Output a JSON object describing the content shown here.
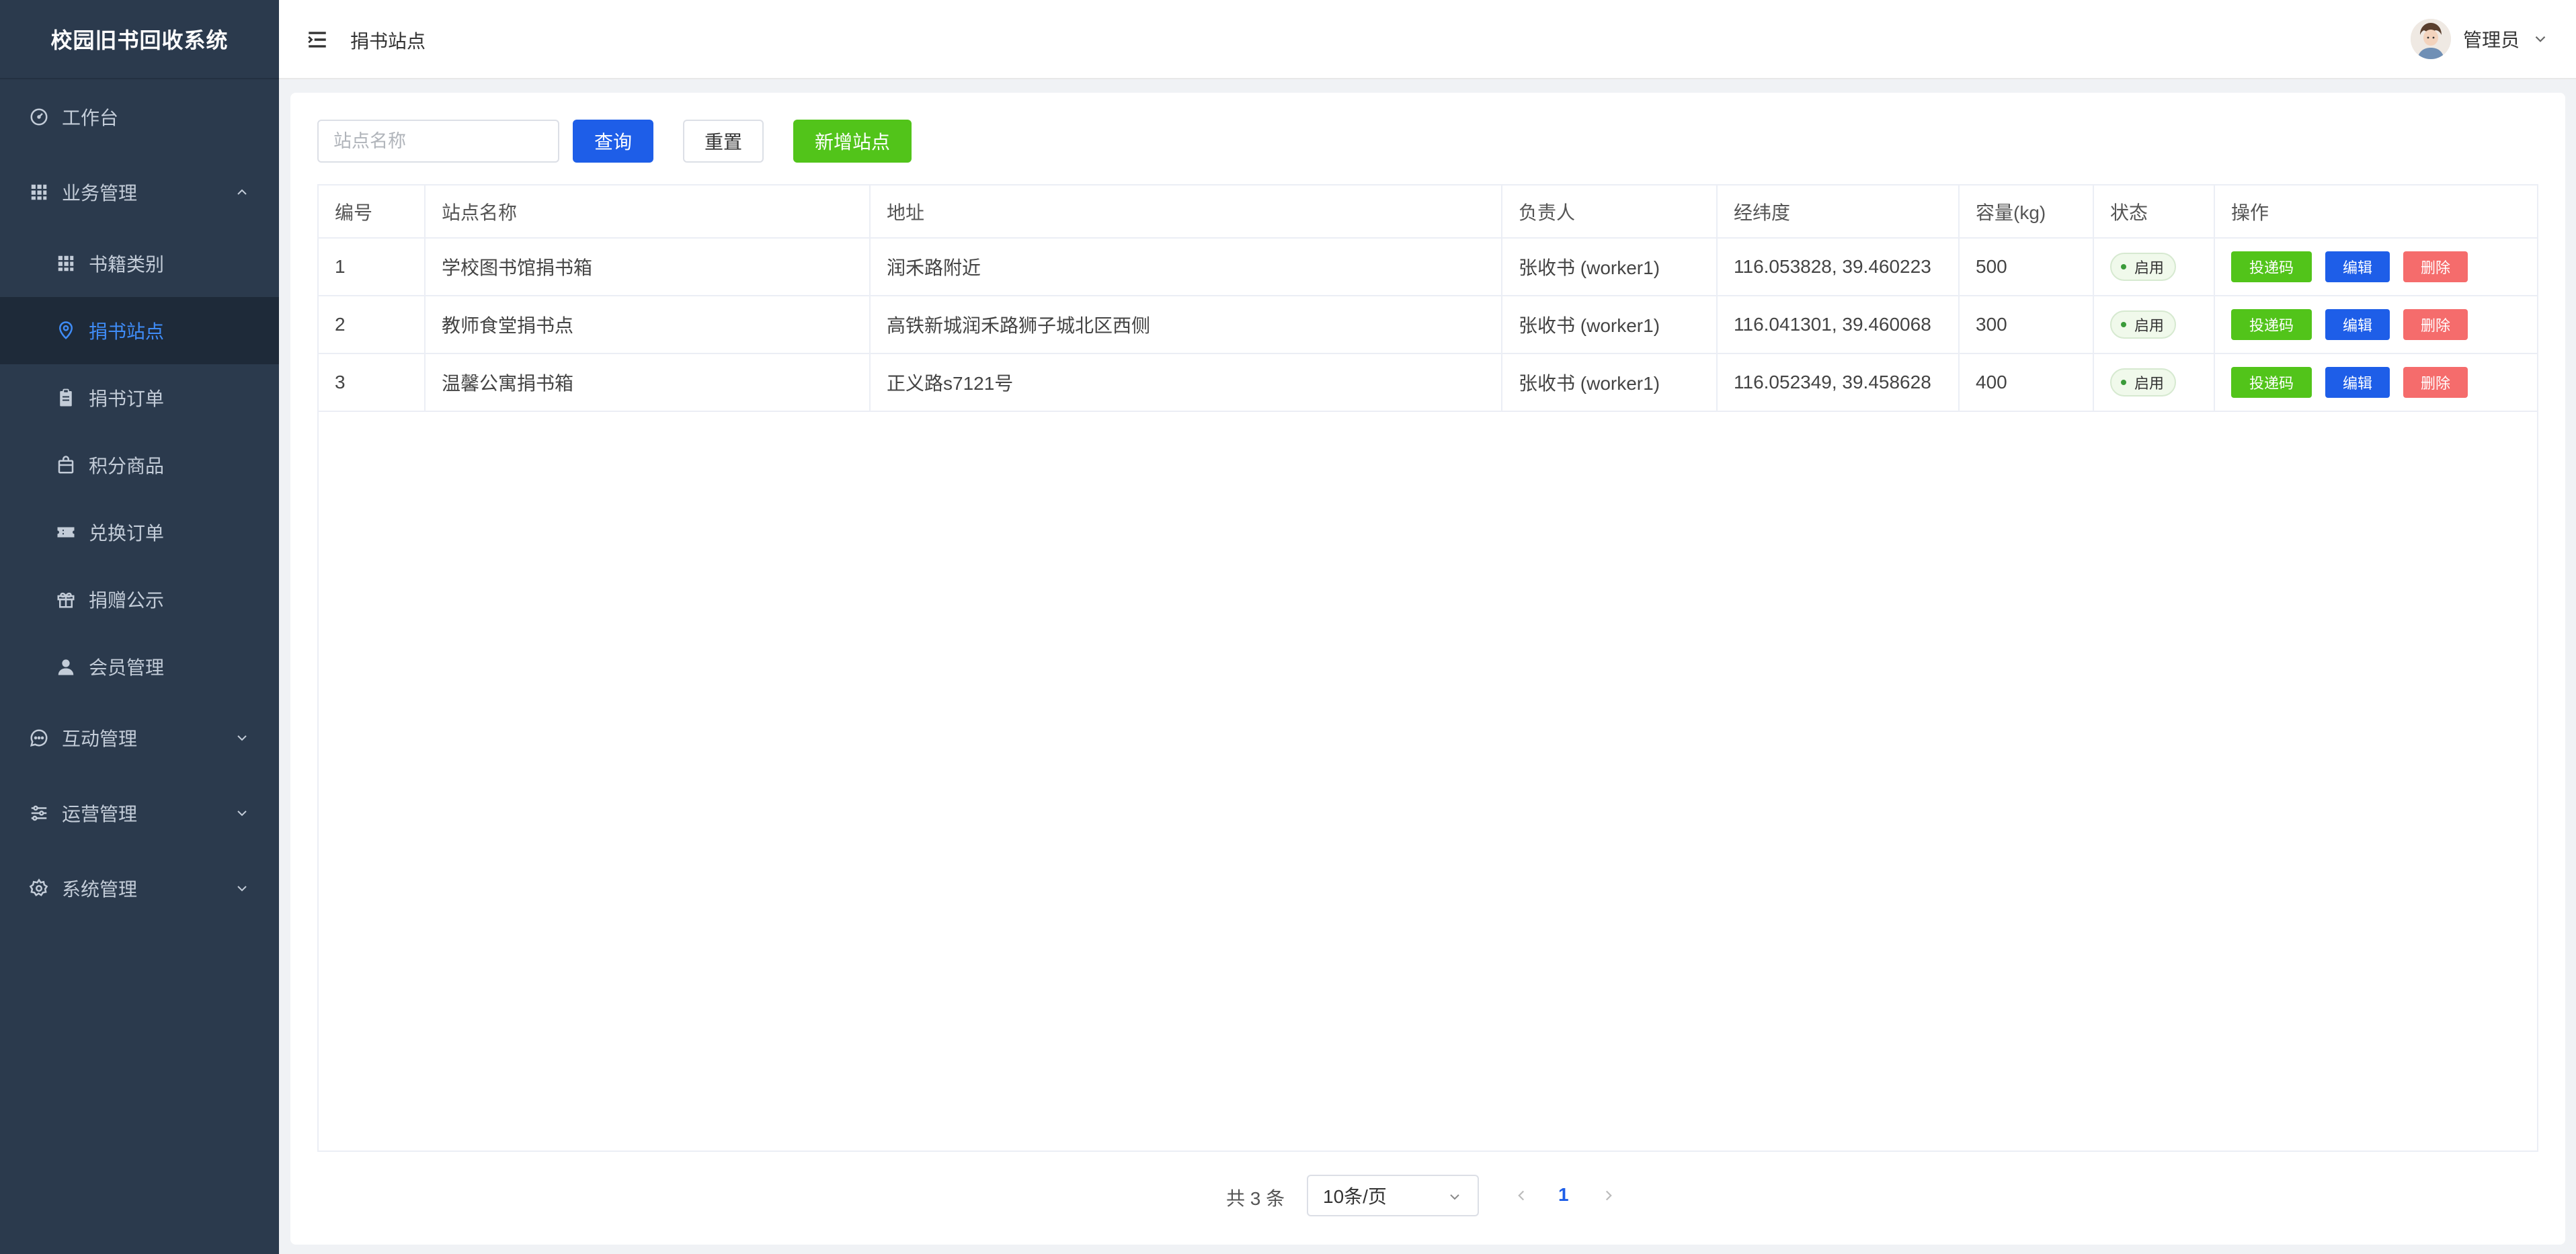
{
  "app": {
    "title": "校园旧书回收系统"
  },
  "sidebar": {
    "items": [
      {
        "label": "工作台",
        "icon": "gauge-icon"
      },
      {
        "label": "业务管理",
        "icon": "grid-icon",
        "expanded": true
      },
      {
        "label": "书籍类别",
        "icon": "grid-icon"
      },
      {
        "label": "捐书站点",
        "icon": "location-pin-icon",
        "active": true
      },
      {
        "label": "捐书订单",
        "icon": "clipboard-icon"
      },
      {
        "label": "积分商品",
        "icon": "shopping-bag-icon"
      },
      {
        "label": "兑换订单",
        "icon": "ticket-icon"
      },
      {
        "label": "捐赠公示",
        "icon": "gift-icon"
      },
      {
        "label": "会员管理",
        "icon": "user-icon"
      },
      {
        "label": "互动管理",
        "icon": "chat-icon",
        "expanded": false
      },
      {
        "label": "运营管理",
        "icon": "sliders-icon",
        "expanded": false
      },
      {
        "label": "系统管理",
        "icon": "gear-icon",
        "expanded": false
      }
    ]
  },
  "header": {
    "page_title": "捐书站点",
    "user_name": "管理员"
  },
  "toolbar": {
    "search_placeholder": "站点名称",
    "search_value": "",
    "query_label": "查询",
    "reset_label": "重置",
    "add_label": "新增站点"
  },
  "table": {
    "columns": [
      "编号",
      "站点名称",
      "地址",
      "负责人",
      "经纬度",
      "容量(kg)",
      "状态",
      "操作"
    ],
    "rows": [
      {
        "id": "1",
        "name": "学校图书馆捐书箱",
        "address": "润禾路附近",
        "manager": "张收书 (worker1)",
        "coords": "116.053828, 39.460223",
        "capacity": "500",
        "status": "启用"
      },
      {
        "id": "2",
        "name": "教师食堂捐书点",
        "address": "高铁新城润禾路狮子城北区西侧",
        "manager": "张收书 (worker1)",
        "coords": "116.041301, 39.460068",
        "capacity": "300",
        "status": "启用"
      },
      {
        "id": "3",
        "name": "温馨公寓捐书箱",
        "address": "正义路s7121号",
        "manager": "张收书 (worker1)",
        "coords": "116.052349, 39.458628",
        "capacity": "400",
        "status": "启用"
      }
    ],
    "actions": {
      "code": "投递码",
      "edit": "编辑",
      "delete": "删除"
    }
  },
  "pagination": {
    "total_text": "共 3 条",
    "page_size": "10条/页",
    "current_page": "1"
  },
  "colors": {
    "sidebar_bg": "#2b3a4d",
    "active_accent": "#3f8cf7",
    "primary": "#1e5ee8",
    "success": "#52c41a",
    "danger": "#f56c6c"
  }
}
